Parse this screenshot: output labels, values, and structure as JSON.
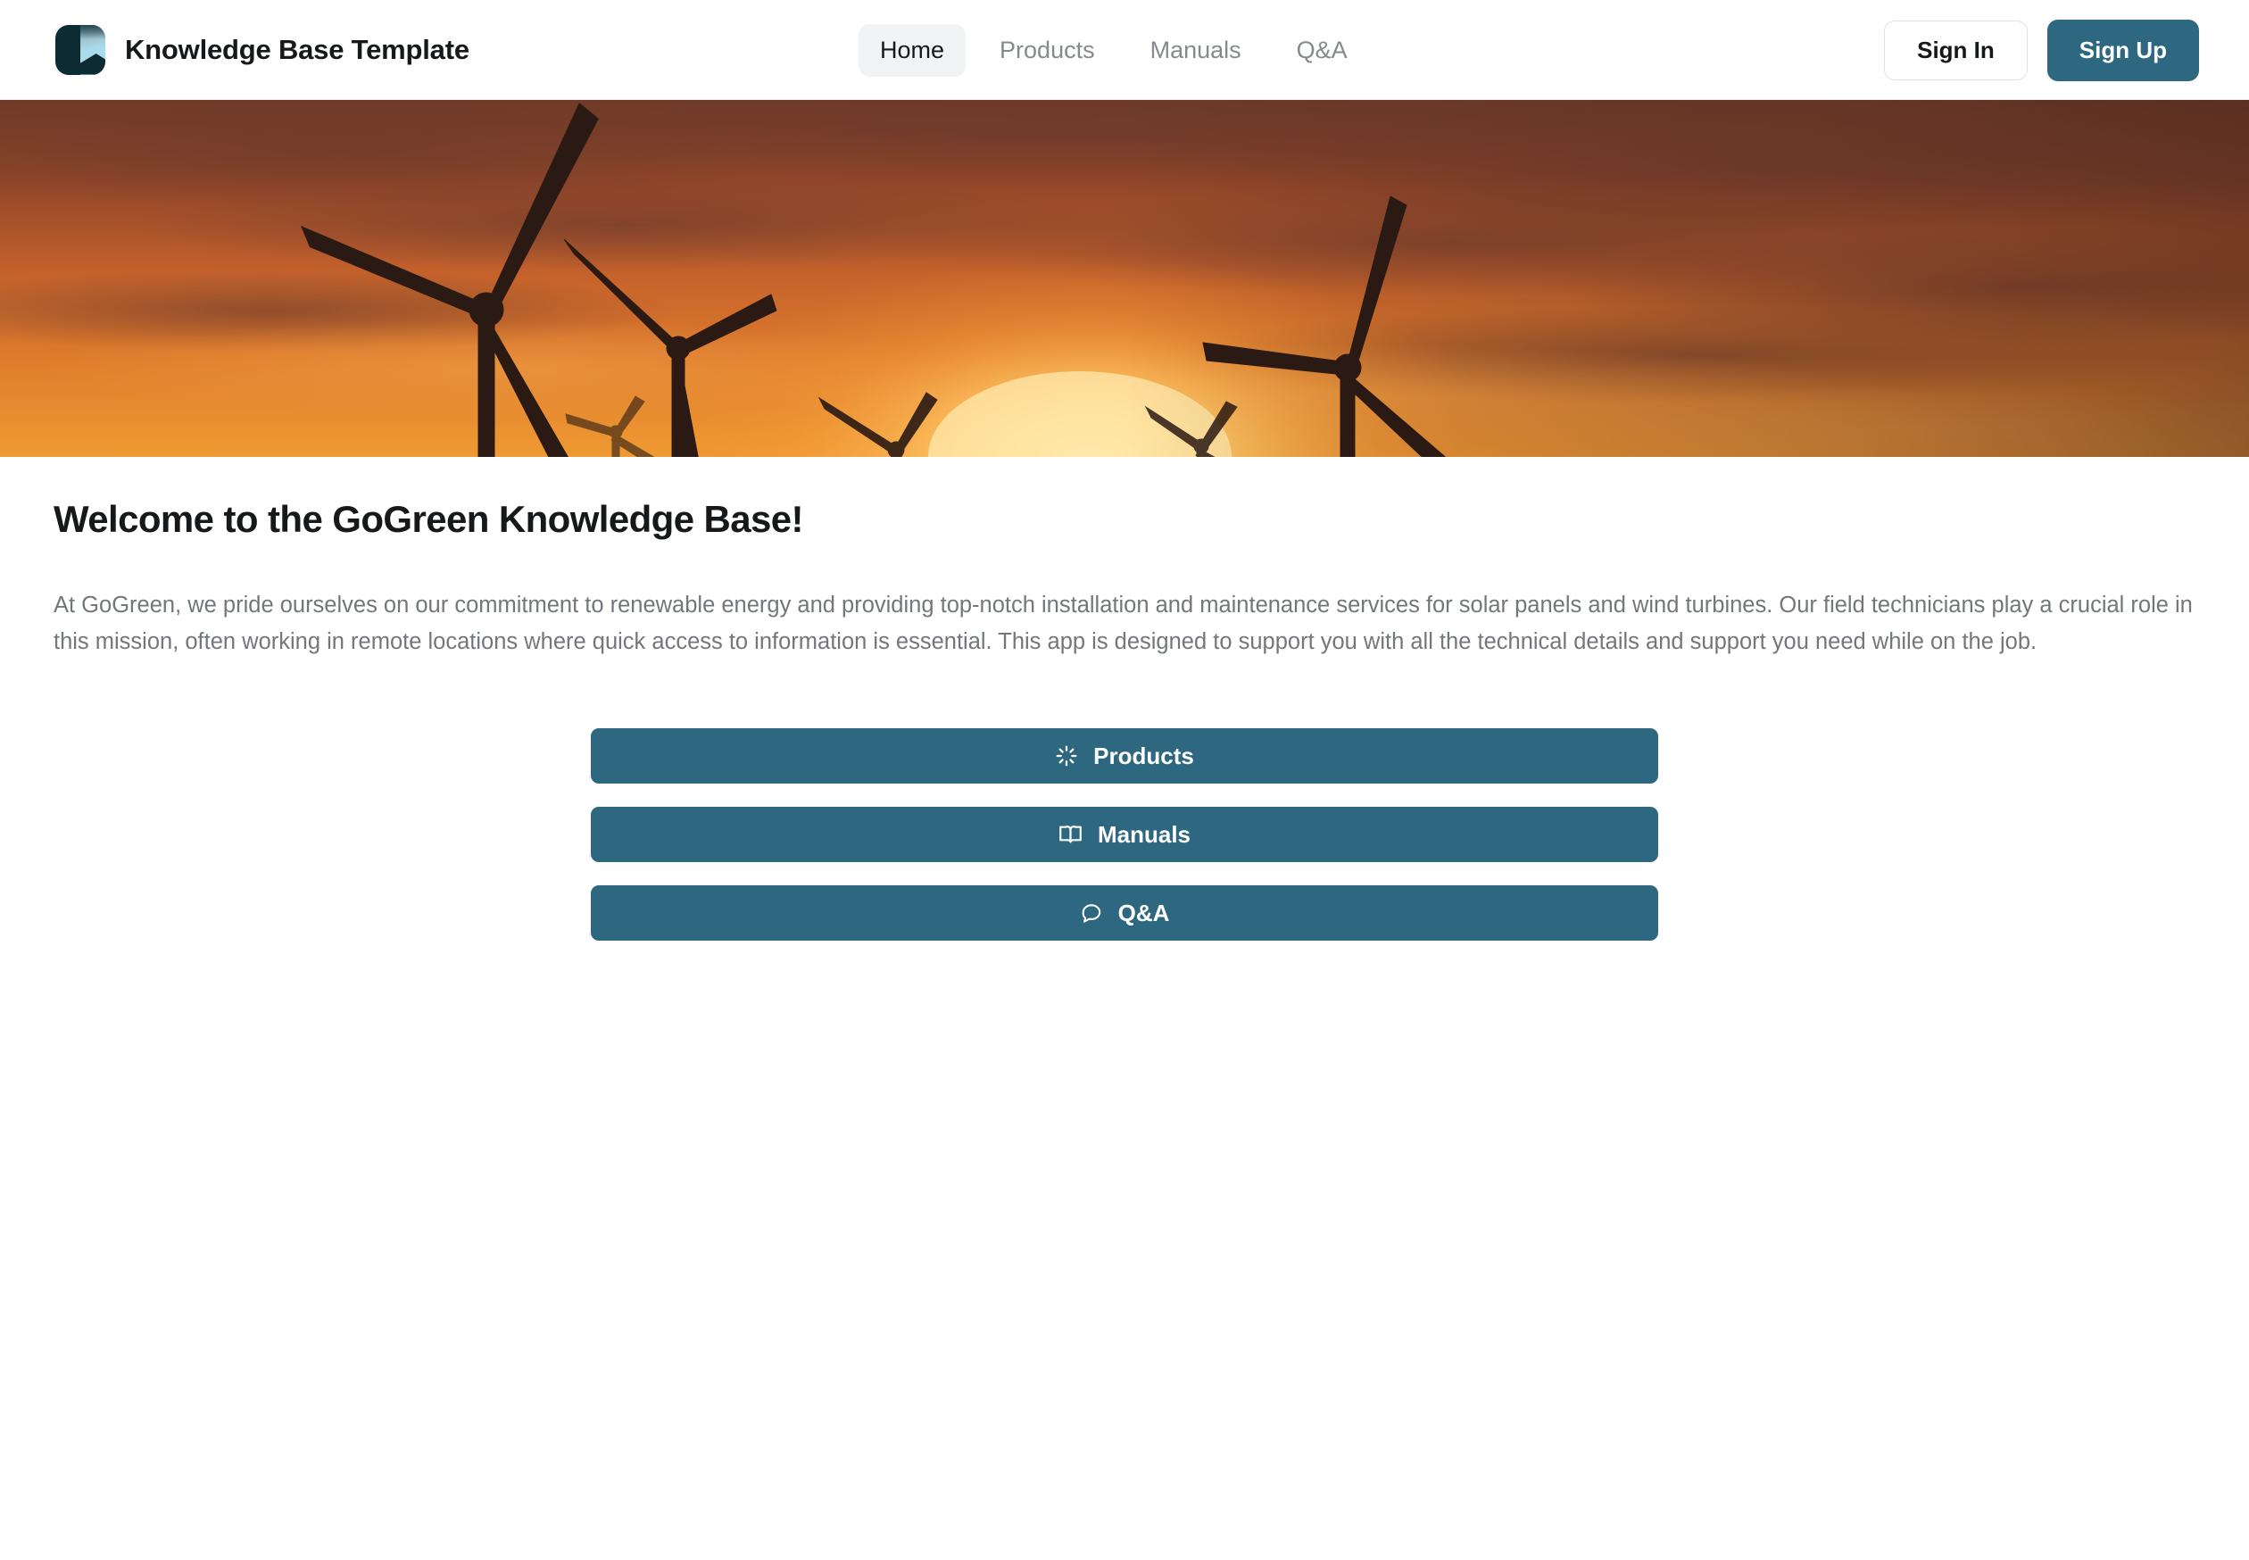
{
  "header": {
    "brand_title": "Knowledge Base Template",
    "logo_icon": "knowledge-base-logo-icon",
    "nav": [
      {
        "label": "Home",
        "active": true
      },
      {
        "label": "Products",
        "active": false
      },
      {
        "label": "Manuals",
        "active": false
      },
      {
        "label": "Q&A",
        "active": false
      }
    ],
    "sign_in_label": "Sign In",
    "sign_up_label": "Sign Up",
    "accent_color": "#2e6780",
    "active_tab_bg": "#f2f3f4"
  },
  "hero": {
    "alt": "Wind turbines silhouetted against an orange sunset sky",
    "sky_top_color": "#7a3f2a",
    "sky_mid_color": "#d4702f",
    "sun_glow_color": "#ffd27a",
    "turbine_color": "#2a1710"
  },
  "main": {
    "title": "Welcome to the GoGreen Knowledge Base!",
    "intro": "At GoGreen, we pride ourselves on our commitment to renewable energy and providing top-notch installation and maintenance services for solar panels and wind turbines. Our field technicians play a crucial role in this mission, often working in remote locations where quick access to information is essential. This app is designed to support you with all the technical details and support you need while on the job.",
    "cta_buttons": [
      {
        "label": "Products",
        "icon": "sun-rays-icon"
      },
      {
        "label": "Manuals",
        "icon": "open-book-icon"
      },
      {
        "label": "Q&A",
        "icon": "speech-bubble-icon"
      }
    ]
  }
}
